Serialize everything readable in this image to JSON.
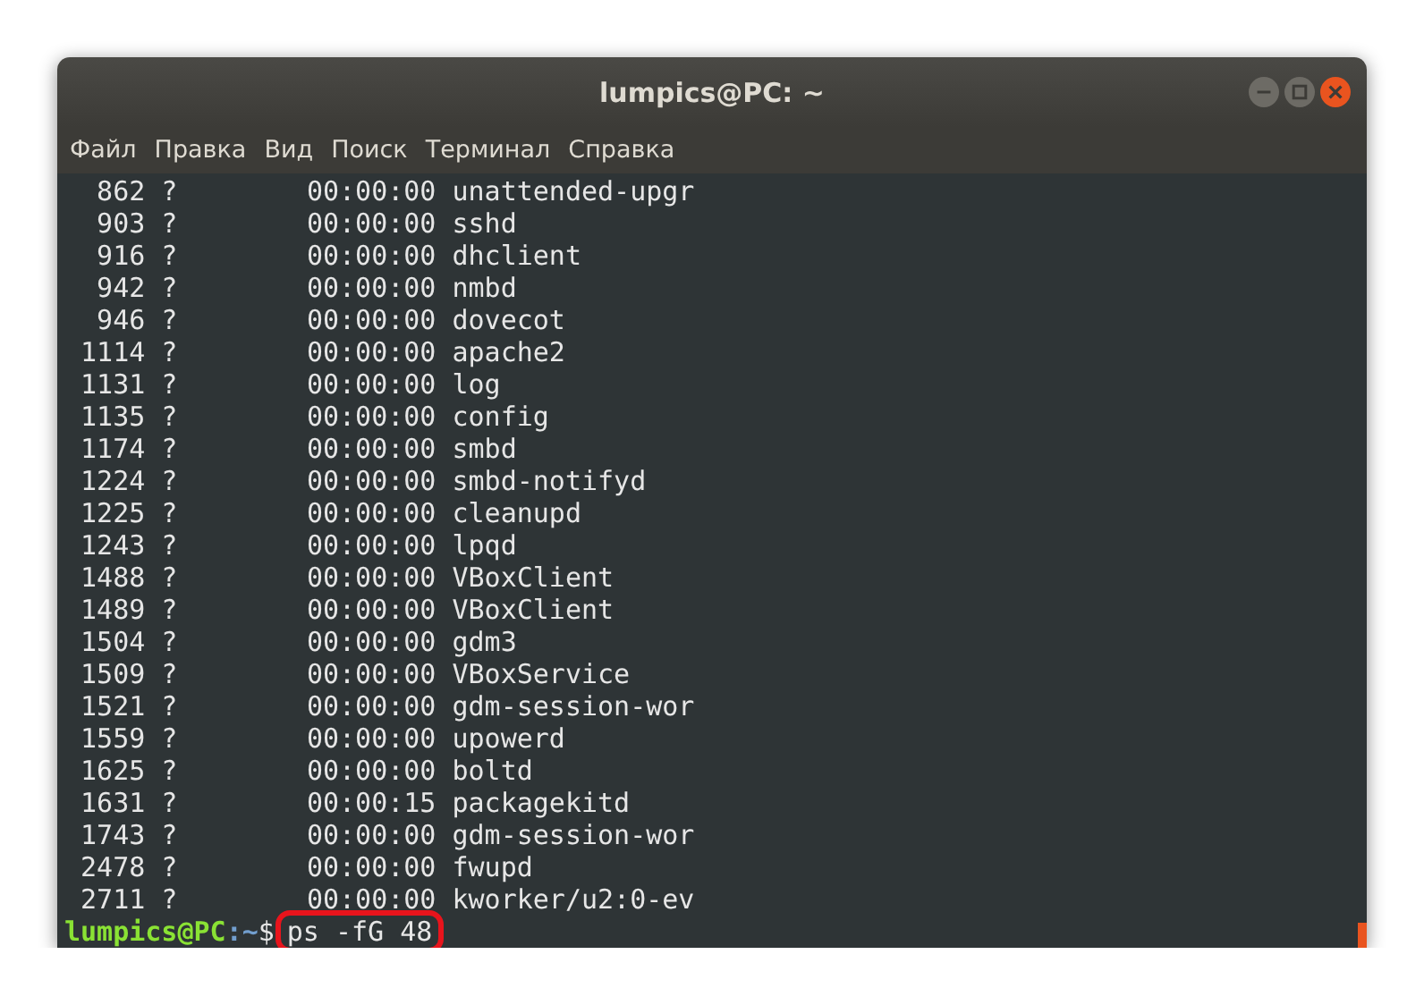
{
  "window": {
    "title": "lumpics@PC: ~"
  },
  "menu": [
    "Файл",
    "Правка",
    "Вид",
    "Поиск",
    "Терминал",
    "Справка"
  ],
  "lines": [
    "  862 ?        00:00:00 unattended-upgr",
    "  903 ?        00:00:00 sshd",
    "  916 ?        00:00:00 dhclient",
    "  942 ?        00:00:00 nmbd",
    "  946 ?        00:00:00 dovecot",
    " 1114 ?        00:00:00 apache2",
    " 1131 ?        00:00:00 log",
    " 1135 ?        00:00:00 config",
    " 1174 ?        00:00:00 smbd",
    " 1224 ?        00:00:00 smbd-notifyd",
    " 1225 ?        00:00:00 cleanupd",
    " 1243 ?        00:00:00 lpqd",
    " 1488 ?        00:00:00 VBoxClient",
    " 1489 ?        00:00:00 VBoxClient",
    " 1504 ?        00:00:00 gdm3",
    " 1509 ?        00:00:00 VBoxService",
    " 1521 ?        00:00:00 gdm-session-wor",
    " 1559 ?        00:00:00 upowerd",
    " 1625 ?        00:00:00 boltd",
    " 1631 ?        00:00:15 packagekitd",
    " 1743 ?        00:00:00 gdm-session-wor",
    " 2478 ?        00:00:00 fwupd",
    " 2711 ?        00:00:00 kworker/u2:0-ev"
  ],
  "prompt": {
    "user_host": "lumpics@PC",
    "path": ":~",
    "symbol": "$",
    "command": "ps -fG 48",
    "highlighted": true
  }
}
